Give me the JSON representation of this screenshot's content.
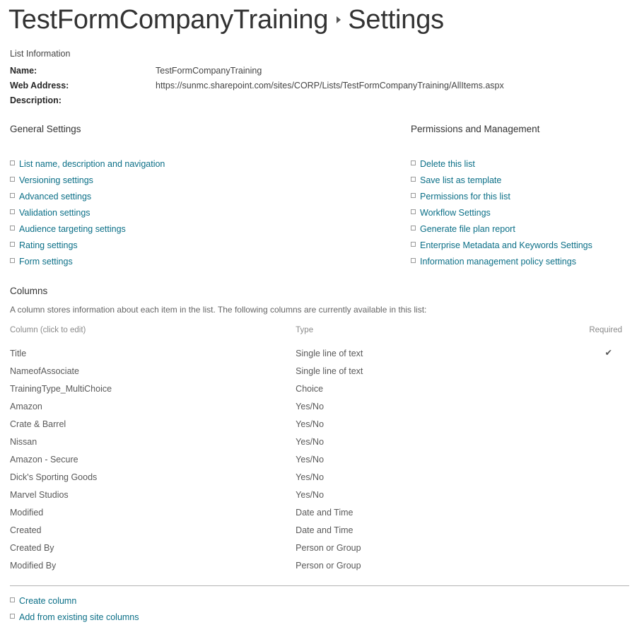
{
  "header": {
    "site_title": "TestFormCompanyTraining",
    "separator_icon": "caret-right-icon",
    "page_title": "Settings"
  },
  "list_information": {
    "section_label": "List Information",
    "rows": [
      {
        "label": "Name:",
        "value": "TestFormCompanyTraining"
      },
      {
        "label": "Web Address:",
        "value": "https://sunmc.sharepoint.com/sites/CORP/Lists/TestFormCompanyTraining/AllItems.aspx"
      },
      {
        "label": "Description:",
        "value": ""
      }
    ]
  },
  "general_settings": {
    "heading": "General Settings",
    "links": [
      {
        "label": "List name, description and navigation"
      },
      {
        "label": "Versioning settings"
      },
      {
        "label": "Advanced settings"
      },
      {
        "label": "Validation settings"
      },
      {
        "label": "Audience targeting settings"
      },
      {
        "label": "Rating settings"
      },
      {
        "label": "Form settings"
      }
    ]
  },
  "permissions_management": {
    "heading": "Permissions and Management",
    "links": [
      {
        "label": "Delete this list"
      },
      {
        "label": "Save list as template"
      },
      {
        "label": "Permissions for this list"
      },
      {
        "label": "Workflow Settings"
      },
      {
        "label": "Generate file plan report"
      },
      {
        "label": "Enterprise Metadata and Keywords Settings"
      },
      {
        "label": "Information management policy settings"
      }
    ]
  },
  "columns_section": {
    "heading": "Columns",
    "description": "A column stores information about each item in the list. The following columns are currently available in this list:",
    "table": {
      "headers": {
        "name": "Column (click to edit)",
        "type": "Type",
        "required": "Required"
      },
      "rows": [
        {
          "name": "Title",
          "type": "Single line of text",
          "required": "✔"
        },
        {
          "name": "NameofAssociate",
          "type": "Single line of text",
          "required": ""
        },
        {
          "name": "TrainingType_MultiChoice",
          "type": "Choice",
          "required": ""
        },
        {
          "name": "Amazon",
          "type": "Yes/No",
          "required": ""
        },
        {
          "name": "Crate & Barrel",
          "type": "Yes/No",
          "required": ""
        },
        {
          "name": "Nissan",
          "type": "Yes/No",
          "required": ""
        },
        {
          "name": "Amazon - Secure",
          "type": "Yes/No",
          "required": ""
        },
        {
          "name": "Dick's Sporting Goods",
          "type": "Yes/No",
          "required": ""
        },
        {
          "name": "Marvel Studios",
          "type": "Yes/No",
          "required": ""
        },
        {
          "name": "Modified",
          "type": "Date and Time",
          "required": ""
        },
        {
          "name": "Created",
          "type": "Date and Time",
          "required": ""
        },
        {
          "name": "Created By",
          "type": "Person or Group",
          "required": ""
        },
        {
          "name": "Modified By",
          "type": "Person or Group",
          "required": ""
        }
      ]
    },
    "footer_links": [
      {
        "label": "Create column"
      },
      {
        "label": "Add from existing site columns"
      }
    ]
  },
  "colors": {
    "link": "#0b6f87",
    "heading": "#333333",
    "body_text": "#595959",
    "muted_text": "#8a8a8a",
    "background": "#ffffff"
  }
}
